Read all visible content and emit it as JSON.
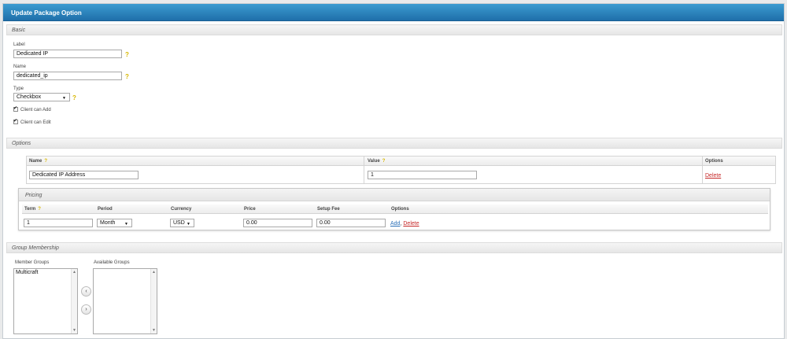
{
  "window": {
    "title": "Update Package Option"
  },
  "basic": {
    "section_title": "Basic",
    "label_field": {
      "label": "Label",
      "value": "Dedicated IP"
    },
    "name_field": {
      "label": "Name",
      "value": "dedicated_ip"
    },
    "type_field": {
      "label": "Type",
      "value": "Checkbox"
    },
    "client_can_add": {
      "label": "Client can Add",
      "checked": true
    },
    "client_can_edit": {
      "label": "Client can Edit",
      "checked": true
    },
    "help_glyph": "?"
  },
  "options": {
    "section_title": "Options",
    "headers": {
      "name": "Name",
      "value": "Value",
      "options": "Options"
    },
    "rows": [
      {
        "name": "Dedicated IP Address",
        "value": "1",
        "action": "Delete"
      }
    ]
  },
  "pricing": {
    "title": "Pricing",
    "headers": {
      "term": "Term",
      "period": "Period",
      "currency": "Currency",
      "price": "Price",
      "setup_fee": "Setup Fee",
      "options": "Options"
    },
    "rows": [
      {
        "term": "1",
        "period": "Month",
        "currency": "USD",
        "price": "0.00",
        "setup_fee": "0.00",
        "add": "Add",
        "sep": ",",
        "delete": "Delete"
      }
    ]
  },
  "group_membership": {
    "section_title": "Group Membership",
    "member_groups_label": "Member Groups",
    "available_groups_label": "Available Groups",
    "member_groups": [
      "Multicraft"
    ],
    "available_groups": [],
    "move_left": "‹",
    "move_right": "›"
  },
  "colors": {
    "header_blue": "#2a83c0",
    "link_blue": "#2a6fb7",
    "delete_red": "#c62828",
    "help_yellow": "#d7b700"
  }
}
